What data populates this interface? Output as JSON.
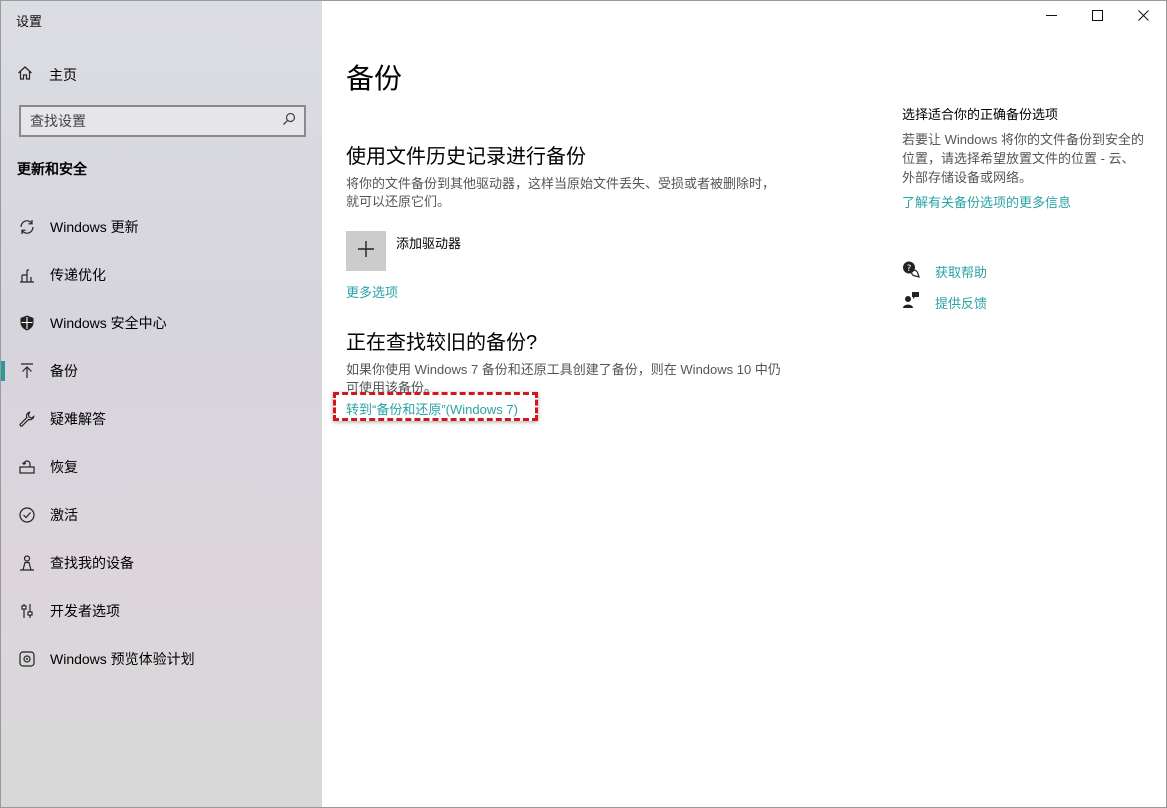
{
  "window": {
    "title": "设置",
    "controls": {
      "minimize": "minimize-icon",
      "maximize": "maximize-icon",
      "close": "close-icon"
    }
  },
  "sidebar": {
    "home_label": "主页",
    "search_placeholder": "查找设置",
    "section_title": "更新和安全",
    "items": [
      {
        "label": "Windows 更新",
        "icon": "refresh-icon"
      },
      {
        "label": "传递优化",
        "icon": "delivery-optimization-icon"
      },
      {
        "label": "Windows 安全中心",
        "icon": "shield-icon"
      },
      {
        "label": "备份",
        "icon": "backup-arrow-icon",
        "active": true
      },
      {
        "label": "疑难解答",
        "icon": "wrench-icon"
      },
      {
        "label": "恢复",
        "icon": "recovery-icon"
      },
      {
        "label": "激活",
        "icon": "check-circle-icon"
      },
      {
        "label": "查找我的设备",
        "icon": "person-location-icon"
      },
      {
        "label": "开发者选项",
        "icon": "developer-sliders-icon"
      },
      {
        "label": "Windows 预览体验计划",
        "icon": "insider-icon"
      }
    ]
  },
  "main": {
    "title": "备份",
    "file_history": {
      "heading": "使用文件历史记录进行备份",
      "description": "将你的文件备份到其他驱动器，这样当原始文件丢失、受损或者被删除时，就可以还原它们。",
      "add_drive_label": "添加驱动器",
      "more_options_link": "更多选项"
    },
    "older_backup": {
      "heading": "正在查找较旧的备份?",
      "description": "如果你使用 Windows 7 备份和还原工具创建了备份，则在 Windows 10 中仍可使用该备份。",
      "link": "转到“备份和还原”(Windows 7)"
    },
    "accent_color": "#2aa3a6",
    "highlight_color": "#d1161c"
  },
  "right_panel": {
    "title": "选择适合你的正确备份选项",
    "description": "若要让 Windows 将你的文件备份到安全的位置，请选择希望放置文件的位置 - 云、外部存储设备或网络。",
    "learn_more_link": "了解有关备份选项的更多信息",
    "help_label": "获取帮助",
    "feedback_label": "提供反馈"
  }
}
